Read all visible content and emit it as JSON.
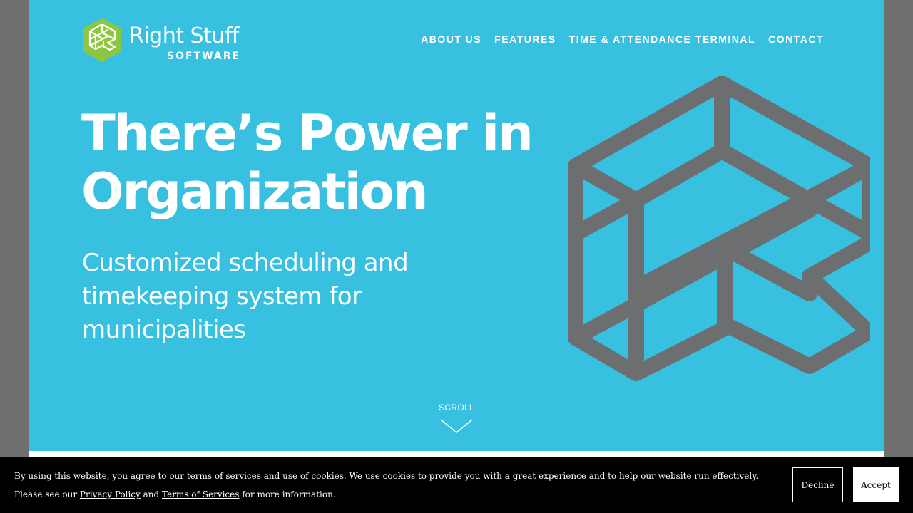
{
  "brand": {
    "name": "Right Stuff",
    "tagline": "SOFTWARE",
    "logo_icon": "right-stuff-hexagon-logo",
    "logo_color": "#8dc63f"
  },
  "nav": {
    "items": [
      {
        "label": "ABOUT US"
      },
      {
        "label": "FEATURES"
      },
      {
        "label": "TIME & ATTENDANCE TERMINAL"
      },
      {
        "label": "CONTACT"
      }
    ]
  },
  "hero": {
    "headline": "There’s Power in Organization",
    "subheadline": "Customized scheduling and timekeeping system for municipalities",
    "background_color": "#38c0e1",
    "graphic": "isometric-r-logo-outline",
    "graphic_color": "#6d6e70",
    "scroll_label": "SCROLL",
    "scroll_icon": "chevron-down-icon"
  },
  "cookie_banner": {
    "text_before": "By using this website, you agree to our terms of services and use of cookies. We use cookies to provide you with a great experience and to help our website run effectively. Please see our ",
    "privacy_link": "Privacy Policy",
    "text_and": " and ",
    "terms_link": "Terms of Services",
    "text_after": " for more information.",
    "decline_label": "Decline",
    "accept_label": "Accept"
  }
}
